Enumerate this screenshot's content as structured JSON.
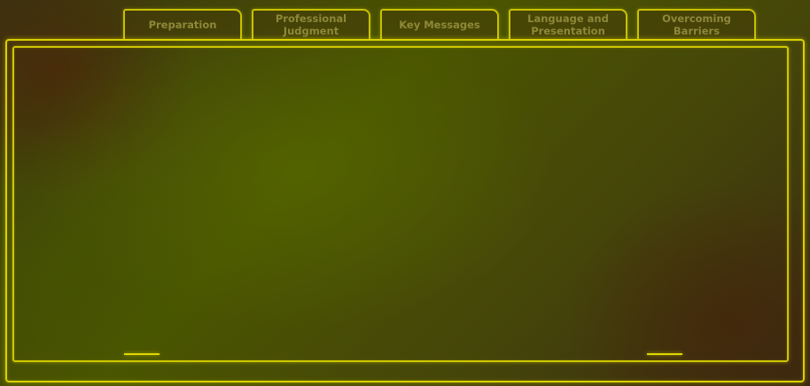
{
  "tabs": [
    {
      "label": "Preparation"
    },
    {
      "label": "Professional Judgment"
    },
    {
      "label": "Key Messages"
    },
    {
      "label": "Language and Presentation"
    },
    {
      "label": "Overcoming Barriers"
    }
  ],
  "theme": {
    "frame_color": "#d9d000",
    "tab_text_color": "#8e8838",
    "background_color": "#4a5500"
  }
}
